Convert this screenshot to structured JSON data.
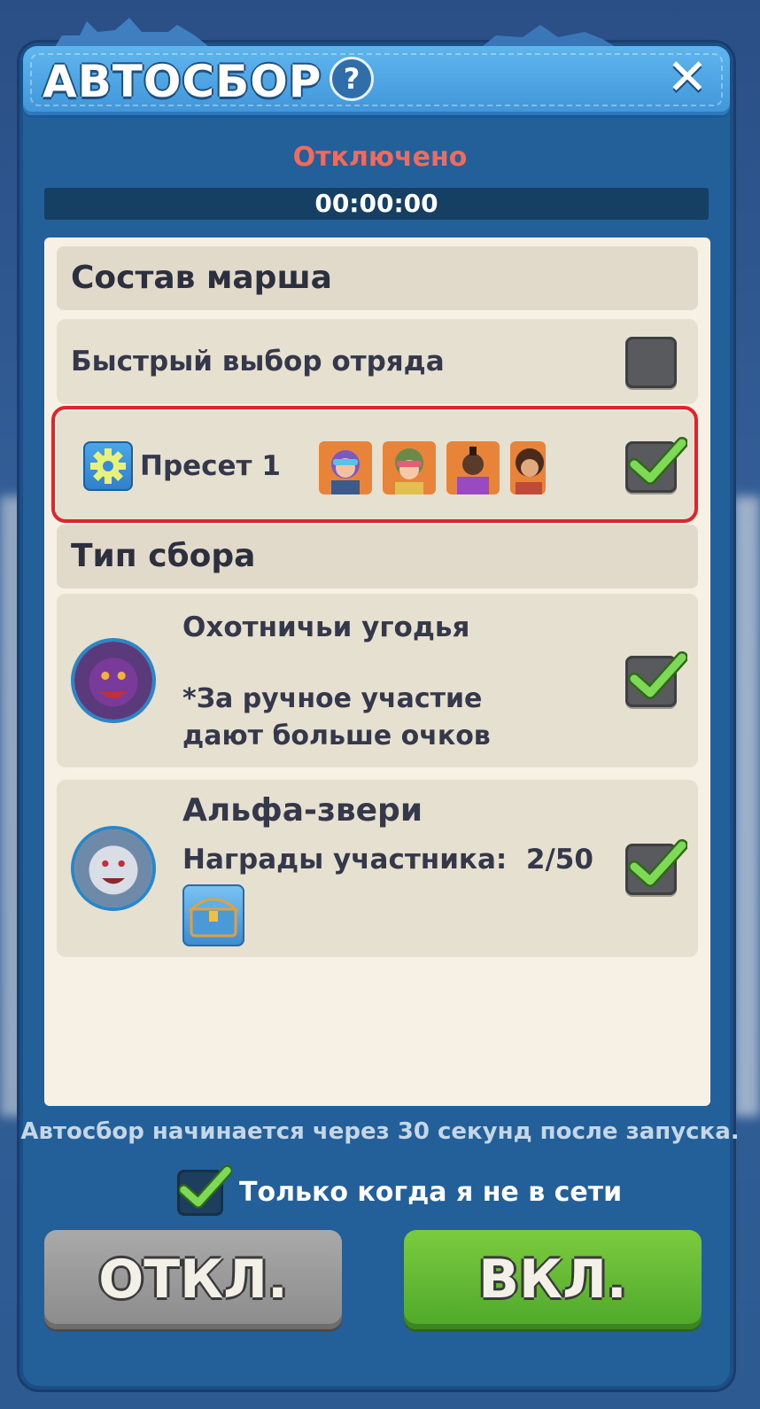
{
  "header": {
    "title": "АВТОСБОР",
    "help_label": "?",
    "close_label": "✕"
  },
  "status": {
    "text": "Отключено",
    "timer": "00:00:00"
  },
  "march": {
    "heading": "Состав марша",
    "quick_select": {
      "label": "Быстрый выбор отряда",
      "checked": false
    },
    "preset": {
      "label": "Пресет 1",
      "checked": true,
      "heroes": [
        "hero-1",
        "hero-2",
        "hero-3",
        "hero-4"
      ]
    }
  },
  "gather": {
    "heading": "Тип сбора",
    "items": [
      {
        "title": "Охотничьи угодья",
        "note": "*За ручное участие дают больше очков",
        "checked": true
      },
      {
        "title": "Альфа-звери",
        "rewards_label": "Награды участника:",
        "rewards_value": "2/50",
        "checked": true
      }
    ]
  },
  "footer": {
    "note": "Автосбор начинается через 30 секунд после запуска.",
    "only_offline_label": "Только когда я не в сети",
    "only_offline_checked": true,
    "off_button": "ОТКЛ.",
    "on_button": "ВКЛ."
  },
  "colors": {
    "status_red": "#f26a5c",
    "highlight_red": "#e0242c",
    "accent_green": "#4ea82b",
    "panel_blue": "#23609a"
  }
}
